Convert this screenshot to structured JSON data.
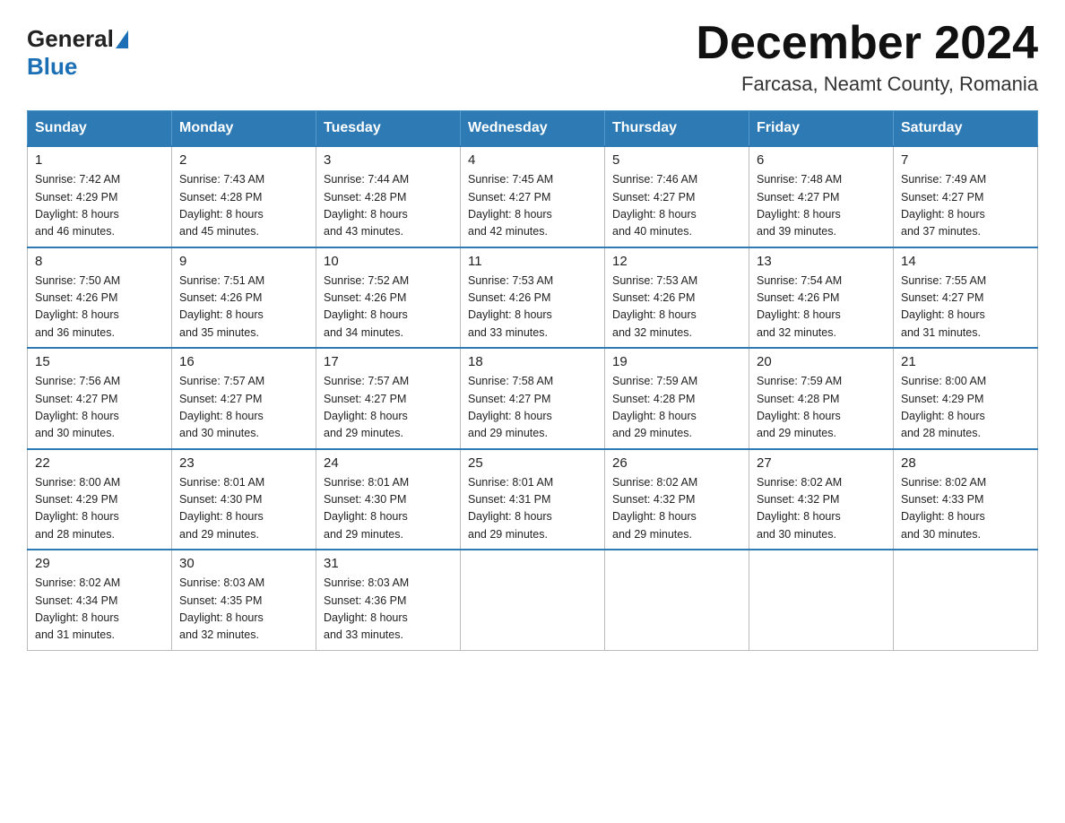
{
  "header": {
    "logo_general": "General",
    "logo_blue": "Blue",
    "main_title": "December 2024",
    "subtitle": "Farcasa, Neamt County, Romania"
  },
  "days_of_week": [
    "Sunday",
    "Monday",
    "Tuesday",
    "Wednesday",
    "Thursday",
    "Friday",
    "Saturday"
  ],
  "weeks": [
    [
      {
        "day": "1",
        "sunrise": "7:42 AM",
        "sunset": "4:29 PM",
        "daylight": "8 hours and 46 minutes."
      },
      {
        "day": "2",
        "sunrise": "7:43 AM",
        "sunset": "4:28 PM",
        "daylight": "8 hours and 45 minutes."
      },
      {
        "day": "3",
        "sunrise": "7:44 AM",
        "sunset": "4:28 PM",
        "daylight": "8 hours and 43 minutes."
      },
      {
        "day": "4",
        "sunrise": "7:45 AM",
        "sunset": "4:27 PM",
        "daylight": "8 hours and 42 minutes."
      },
      {
        "day": "5",
        "sunrise": "7:46 AM",
        "sunset": "4:27 PM",
        "daylight": "8 hours and 40 minutes."
      },
      {
        "day": "6",
        "sunrise": "7:48 AM",
        "sunset": "4:27 PM",
        "daylight": "8 hours and 39 minutes."
      },
      {
        "day": "7",
        "sunrise": "7:49 AM",
        "sunset": "4:27 PM",
        "daylight": "8 hours and 37 minutes."
      }
    ],
    [
      {
        "day": "8",
        "sunrise": "7:50 AM",
        "sunset": "4:26 PM",
        "daylight": "8 hours and 36 minutes."
      },
      {
        "day": "9",
        "sunrise": "7:51 AM",
        "sunset": "4:26 PM",
        "daylight": "8 hours and 35 minutes."
      },
      {
        "day": "10",
        "sunrise": "7:52 AM",
        "sunset": "4:26 PM",
        "daylight": "8 hours and 34 minutes."
      },
      {
        "day": "11",
        "sunrise": "7:53 AM",
        "sunset": "4:26 PM",
        "daylight": "8 hours and 33 minutes."
      },
      {
        "day": "12",
        "sunrise": "7:53 AM",
        "sunset": "4:26 PM",
        "daylight": "8 hours and 32 minutes."
      },
      {
        "day": "13",
        "sunrise": "7:54 AM",
        "sunset": "4:26 PM",
        "daylight": "8 hours and 32 minutes."
      },
      {
        "day": "14",
        "sunrise": "7:55 AM",
        "sunset": "4:27 PM",
        "daylight": "8 hours and 31 minutes."
      }
    ],
    [
      {
        "day": "15",
        "sunrise": "7:56 AM",
        "sunset": "4:27 PM",
        "daylight": "8 hours and 30 minutes."
      },
      {
        "day": "16",
        "sunrise": "7:57 AM",
        "sunset": "4:27 PM",
        "daylight": "8 hours and 30 minutes."
      },
      {
        "day": "17",
        "sunrise": "7:57 AM",
        "sunset": "4:27 PM",
        "daylight": "8 hours and 29 minutes."
      },
      {
        "day": "18",
        "sunrise": "7:58 AM",
        "sunset": "4:27 PM",
        "daylight": "8 hours and 29 minutes."
      },
      {
        "day": "19",
        "sunrise": "7:59 AM",
        "sunset": "4:28 PM",
        "daylight": "8 hours and 29 minutes."
      },
      {
        "day": "20",
        "sunrise": "7:59 AM",
        "sunset": "4:28 PM",
        "daylight": "8 hours and 29 minutes."
      },
      {
        "day": "21",
        "sunrise": "8:00 AM",
        "sunset": "4:29 PM",
        "daylight": "8 hours and 28 minutes."
      }
    ],
    [
      {
        "day": "22",
        "sunrise": "8:00 AM",
        "sunset": "4:29 PM",
        "daylight": "8 hours and 28 minutes."
      },
      {
        "day": "23",
        "sunrise": "8:01 AM",
        "sunset": "4:30 PM",
        "daylight": "8 hours and 29 minutes."
      },
      {
        "day": "24",
        "sunrise": "8:01 AM",
        "sunset": "4:30 PM",
        "daylight": "8 hours and 29 minutes."
      },
      {
        "day": "25",
        "sunrise": "8:01 AM",
        "sunset": "4:31 PM",
        "daylight": "8 hours and 29 minutes."
      },
      {
        "day": "26",
        "sunrise": "8:02 AM",
        "sunset": "4:32 PM",
        "daylight": "8 hours and 29 minutes."
      },
      {
        "day": "27",
        "sunrise": "8:02 AM",
        "sunset": "4:32 PM",
        "daylight": "8 hours and 30 minutes."
      },
      {
        "day": "28",
        "sunrise": "8:02 AM",
        "sunset": "4:33 PM",
        "daylight": "8 hours and 30 minutes."
      }
    ],
    [
      {
        "day": "29",
        "sunrise": "8:02 AM",
        "sunset": "4:34 PM",
        "daylight": "8 hours and 31 minutes."
      },
      {
        "day": "30",
        "sunrise": "8:03 AM",
        "sunset": "4:35 PM",
        "daylight": "8 hours and 32 minutes."
      },
      {
        "day": "31",
        "sunrise": "8:03 AM",
        "sunset": "4:36 PM",
        "daylight": "8 hours and 33 minutes."
      },
      null,
      null,
      null,
      null
    ]
  ],
  "labels": {
    "sunrise": "Sunrise:",
    "sunset": "Sunset:",
    "daylight": "Daylight:"
  }
}
